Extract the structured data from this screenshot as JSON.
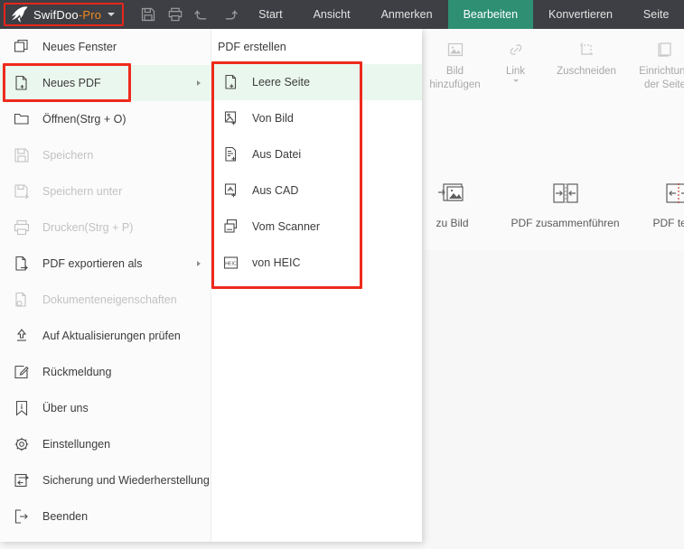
{
  "titlebar": {
    "brand_name": "SwifDoo",
    "brand_suffix": "-Pro",
    "logo_icon": "swift-bird-logo",
    "caret_icon": "chevron-down-icon",
    "quick_tools": [
      {
        "name": "save-icon",
        "label": "Speichern"
      },
      {
        "name": "print-icon",
        "label": "Drucken"
      },
      {
        "name": "undo-icon",
        "label": "Rückgängig"
      },
      {
        "name": "redo-icon",
        "label": "Wiederholen"
      }
    ],
    "tabs": [
      {
        "label": "Start",
        "active": false
      },
      {
        "label": "Ansicht",
        "active": false
      },
      {
        "label": "Anmerken",
        "active": false
      },
      {
        "label": "Bearbeiten",
        "active": true
      },
      {
        "label": "Konvertieren",
        "active": false
      },
      {
        "label": "Seite",
        "active": false
      }
    ],
    "active_tab": "Bearbeiten"
  },
  "ribbon": {
    "items": [
      {
        "label": "Bild\nhinzufügen",
        "icon": "image-add-icon",
        "has_caret": false
      },
      {
        "label": "Link",
        "icon": "link-icon",
        "has_caret": true
      },
      {
        "label": "Zuschneiden",
        "icon": "crop-icon",
        "has_caret": false
      },
      {
        "label": "Einrichtung\nder Seite",
        "icon": "page-setup-icon",
        "has_caret": false
      }
    ]
  },
  "toolstrip": {
    "items": [
      {
        "label": "zu Bild",
        "icon": "pdf-to-image-icon"
      },
      {
        "label": "PDF zusammenführen",
        "icon": "merge-pdf-icon"
      },
      {
        "label": "PDF teilen",
        "icon": "split-pdf-icon"
      }
    ]
  },
  "file_menu": {
    "items": [
      {
        "label": "Neues Fenster",
        "icon": "new-window-icon",
        "disabled": false,
        "has_arrow": false,
        "selected": false
      },
      {
        "label": "Neues PDF",
        "icon": "new-pdf-icon",
        "disabled": false,
        "has_arrow": true,
        "selected": true
      },
      {
        "label": "Öffnen(Strg + O)",
        "icon": "open-folder-icon",
        "disabled": false,
        "has_arrow": false,
        "selected": false
      },
      {
        "label": "Speichern",
        "icon": "save-disk-icon",
        "disabled": true,
        "has_arrow": false,
        "selected": false
      },
      {
        "label": "Speichern unter",
        "icon": "save-as-icon",
        "disabled": true,
        "has_arrow": false,
        "selected": false
      },
      {
        "label": "Drucken(Strg + P)",
        "icon": "printer-icon",
        "disabled": true,
        "has_arrow": false,
        "selected": false
      },
      {
        "label": "PDF exportieren als",
        "icon": "export-icon",
        "disabled": false,
        "has_arrow": true,
        "selected": false
      },
      {
        "label": "Dokumenteneigenschaften",
        "icon": "doc-properties-icon",
        "disabled": true,
        "has_arrow": false,
        "selected": false
      },
      {
        "label": "Auf Aktualisierungen prüfen",
        "icon": "update-icon",
        "disabled": false,
        "has_arrow": false,
        "selected": false
      },
      {
        "label": "Rückmeldung",
        "icon": "feedback-icon",
        "disabled": false,
        "has_arrow": false,
        "selected": false
      },
      {
        "label": "Über uns",
        "icon": "about-icon",
        "disabled": false,
        "has_arrow": false,
        "selected": false
      },
      {
        "label": "Einstellungen",
        "icon": "gear-icon",
        "disabled": false,
        "has_arrow": false,
        "selected": false
      },
      {
        "label": "Sicherung und Wiederherstellung",
        "icon": "backup-restore-icon",
        "disabled": false,
        "has_arrow": false,
        "selected": false
      },
      {
        "label": "Beenden",
        "icon": "exit-icon",
        "disabled": false,
        "has_arrow": false,
        "selected": false
      }
    ]
  },
  "submenu": {
    "title": "PDF erstellen",
    "items": [
      {
        "label": "Leere Seite",
        "icon": "blank-page-icon",
        "selected": true
      },
      {
        "label": "Von Bild",
        "icon": "from-image-icon",
        "selected": false
      },
      {
        "label": "Aus Datei",
        "icon": "from-file-icon",
        "selected": false
      },
      {
        "label": "Aus CAD",
        "icon": "from-cad-icon",
        "selected": false
      },
      {
        "label": "Vom Scanner",
        "icon": "from-scanner-icon",
        "selected": false
      },
      {
        "label": "von HEIC",
        "icon": "from-heic-icon",
        "selected": false
      }
    ]
  },
  "annotations": {
    "highlight_color": "#ee2a1c",
    "boxes": [
      {
        "name": "neues-pdf-highlight",
        "target": "Neues PDF"
      },
      {
        "name": "submenu-highlight",
        "target": "PDF erstellen list"
      }
    ]
  },
  "colors": {
    "titlebar_bg": "#3d3f44",
    "active_tab_bg": "#2e8f72",
    "brand_accent": "#f08a1e",
    "selection_bg": "#eaf7ef",
    "annotation_red": "#ee2a1c"
  }
}
